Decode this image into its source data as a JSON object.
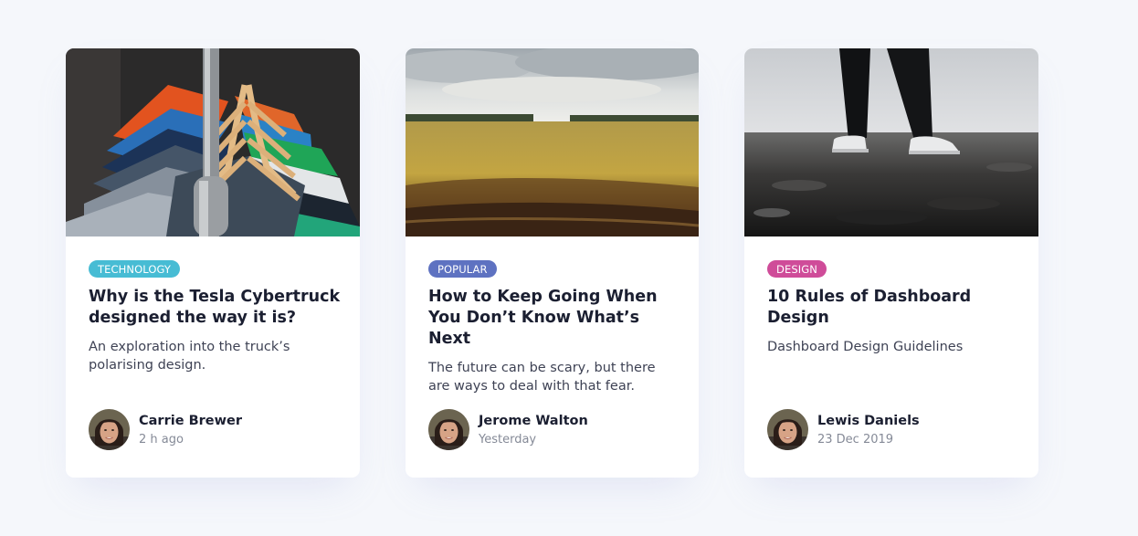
{
  "cards": [
    {
      "image": "clothes-rack-image",
      "tag": "Technology",
      "tag_color": "#47bcd4",
      "title": "Why is the Tesla Cybertruck designed the way it is?",
      "description": "An exploration into the truck’s polarising design.",
      "author": "Carrie Brewer",
      "time": "2 h ago"
    },
    {
      "image": "wheat-field-image",
      "tag": "Popular",
      "tag_color": "#5e72c1",
      "title": "How to Keep Going When You Don’t Know What’s Next",
      "description": "The future can be scary, but there are ways to deal with that fear.",
      "author": "Jerome Walton",
      "time": "Yesterday"
    },
    {
      "image": "sneakers-on-ground-image",
      "tag": "Design",
      "tag_color": "#cf4c99",
      "title": "10 Rules of Dashboard Design",
      "description": "Dashboard Design Guidelines",
      "author": "Lewis Daniels",
      "time": "23 Dec 2019"
    }
  ]
}
